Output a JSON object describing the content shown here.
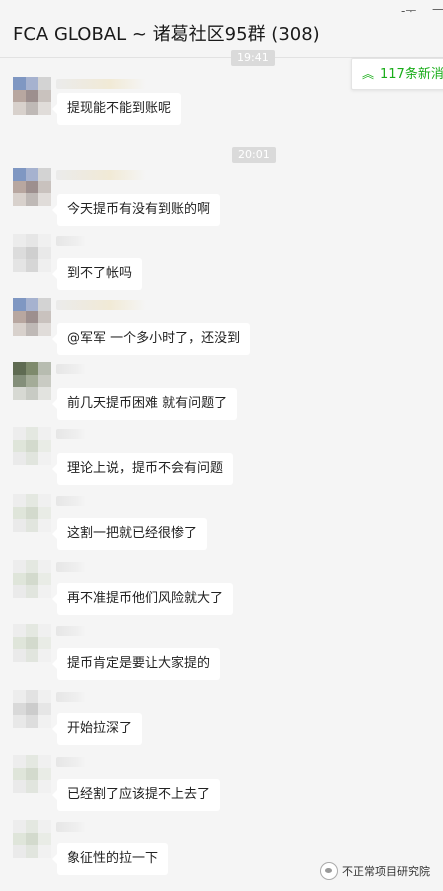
{
  "window": {
    "title": "FCA GLOBAL ~ 诸葛社区95群 (308)",
    "pin_glyph": "-ᅮ",
    "minimize_glyph": "—"
  },
  "new_messages": {
    "arrow_icon": "double-chevron-up-icon",
    "text": "117条新消",
    "color": "#19ad19"
  },
  "timestamps": [
    "19:41",
    "20:01"
  ],
  "messages": [
    {
      "text": "提现能不能到账呢"
    },
    {
      "text": "今天提币有没有到账的啊"
    },
    {
      "text": "到不了帐吗"
    },
    {
      "text": "@军军 一个多小时了，还没到"
    },
    {
      "text": "前几天提币困难 就有问题了"
    },
    {
      "text": "理论上说，提币不会有问题"
    },
    {
      "text": "这割一把就已经很惨了"
    },
    {
      "text": "再不准提币他们风险就大了"
    },
    {
      "text": "提币肯定是要让大家提的"
    },
    {
      "text": "开始拉深了"
    },
    {
      "text": "已经割了应该提不上去了"
    },
    {
      "text": "象征性的拉一下"
    }
  ],
  "watermark": {
    "text": "不正常项目研究院",
    "icon": "wechat-official-account-icon"
  }
}
